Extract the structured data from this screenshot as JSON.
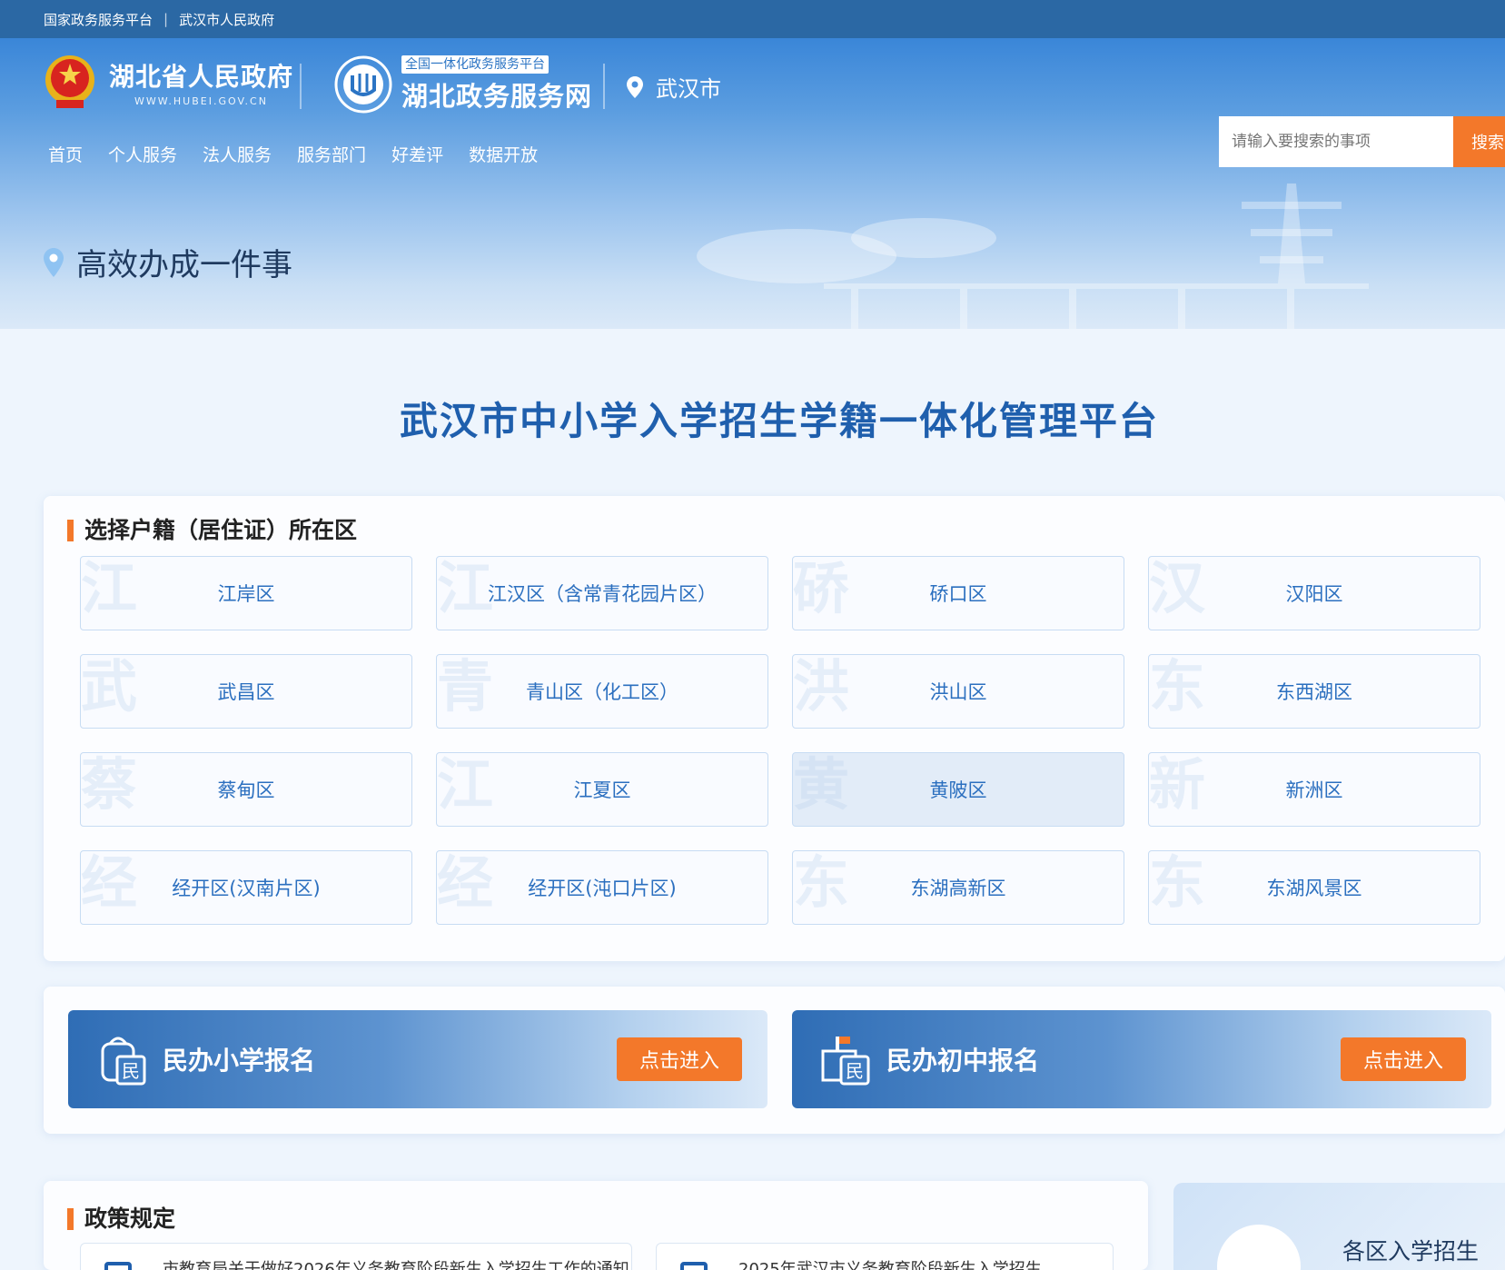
{
  "topbar": {
    "left": "国家政务服务平台",
    "sep": "|",
    "right": "武汉市人民政府"
  },
  "logo_hubei": {
    "cn": "湖北省人民政府",
    "en": "WWW.HUBEI.GOV.CN"
  },
  "logo_zwfw": {
    "badge": "全国一体化政务服务平台",
    "name": "湖北政务服务网"
  },
  "location": {
    "city": "武汉市",
    "icon": "location-pin-icon"
  },
  "nav": [
    "首页",
    "个人服务",
    "法人服务",
    "服务部门",
    "好差评",
    "数据开放"
  ],
  "search": {
    "placeholder": "请输入要搜索的事项",
    "button": "搜索"
  },
  "page_title": "高效办成一件事",
  "main_title": "武汉市中小学入学招生学籍一体化管理平台",
  "district_section": {
    "title": "选择户籍（居住证）所在区",
    "items": [
      {
        "label": "江岸区",
        "wm": "江"
      },
      {
        "label": "江汉区（含常青花园片区）",
        "wm": "江"
      },
      {
        "label": "硚口区",
        "wm": "硚"
      },
      {
        "label": "汉阳区",
        "wm": "汉"
      },
      {
        "label": "武昌区",
        "wm": "武"
      },
      {
        "label": "青山区（化工区）",
        "wm": "青"
      },
      {
        "label": "洪山区",
        "wm": "洪"
      },
      {
        "label": "东西湖区",
        "wm": "东"
      },
      {
        "label": "蔡甸区",
        "wm": "蔡"
      },
      {
        "label": "江夏区",
        "wm": "江"
      },
      {
        "label": "黄陂区",
        "wm": "黄"
      },
      {
        "label": "新洲区",
        "wm": "新"
      },
      {
        "label": "经开区(汉南片区)",
        "wm": "经"
      },
      {
        "label": "经开区(沌口片区)",
        "wm": "经"
      },
      {
        "label": "东湖高新区",
        "wm": "东"
      },
      {
        "label": "东湖风景区",
        "wm": "东"
      }
    ]
  },
  "enroll": [
    {
      "name": "民办小学报名",
      "button": "点击进入",
      "icon_char": "民"
    },
    {
      "name": "民办初中报名",
      "button": "点击进入",
      "icon_char": "民"
    }
  ],
  "policy": {
    "title": "政策规定",
    "items": [
      "市教育局关于做好2026年义务教育阶段新生入学招生工作的通知",
      "2025年武汉市义务教育阶段新生入学招生"
    ]
  },
  "right_card": {
    "title": "各区入学招生"
  },
  "colors": {
    "accent": "#f3782a",
    "primary": "#1f5fad",
    "topbar": "#2b68a4"
  }
}
